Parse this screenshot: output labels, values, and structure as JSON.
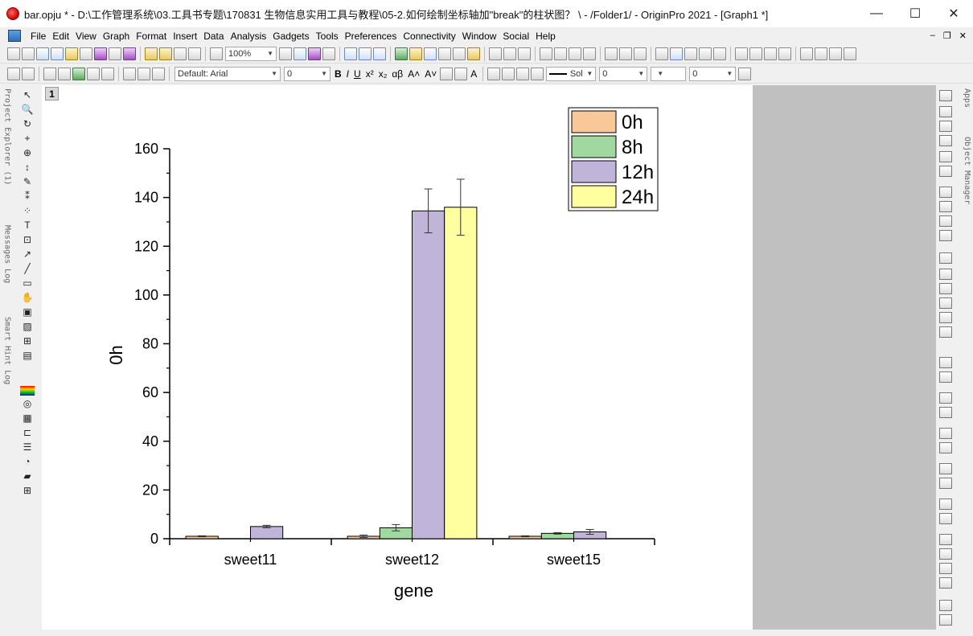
{
  "window": {
    "title": "bar.opju * - D:\\工作管理系统\\03.工具书专题\\170831 生物信息实用工具与教程\\05-2.如何绘制坐标轴加\"break\"的柱状图？ \\ - /Folder1/ - OriginPro 2021 - [Graph1 *]",
    "minimize": "—",
    "maximize": "☐",
    "close": "✕"
  },
  "menu": {
    "items": [
      "File",
      "Edit",
      "View",
      "Graph",
      "Format",
      "Insert",
      "Data",
      "Analysis",
      "Gadgets",
      "Tools",
      "Preferences",
      "Connectivity",
      "Window",
      "Social",
      "Help"
    ],
    "mdi_minimize": "–",
    "mdi_restore": "❐",
    "mdi_close": "✕"
  },
  "toolbar1": {
    "zoom": "100%"
  },
  "toolbar2": {
    "font": "Default: Arial",
    "font_size": "0",
    "line_style": "Sol",
    "line_width": "0",
    "fill_value": "0"
  },
  "left_panels": [
    "Project Explorer (1)",
    "Messages Log",
    "Smart Hint Log"
  ],
  "right_panels": [
    "Apps",
    "Object Manager"
  ],
  "layer_number": "1",
  "chart_data": {
    "type": "bar",
    "xlabel": "gene",
    "ylabel": "0h",
    "ylim": [
      0,
      160
    ],
    "yticks": [
      0,
      20,
      40,
      60,
      80,
      100,
      120,
      140,
      160
    ],
    "categories": [
      "sweet11",
      "sweet12",
      "sweet15"
    ],
    "series": [
      {
        "name": "0h",
        "color": "#f9c89a",
        "values": [
          1.0,
          1.0,
          1.0
        ],
        "errors": [
          0.2,
          0.5,
          0.2
        ]
      },
      {
        "name": "8h",
        "color": "#a0d8a0",
        "values": [
          null,
          4.5,
          2.2
        ],
        "errors": [
          null,
          1.3,
          0.3
        ]
      },
      {
        "name": "12h",
        "color": "#c0b4d8",
        "values": [
          5.0,
          134.5,
          2.8
        ],
        "errors": [
          0.5,
          9.0,
          1.0
        ]
      },
      {
        "name": "24h",
        "color": "#ffffa0",
        "values": [
          null,
          136.0,
          null
        ],
        "errors": [
          null,
          11.5,
          null
        ]
      }
    ],
    "legend": "top-right",
    "grid": false
  }
}
